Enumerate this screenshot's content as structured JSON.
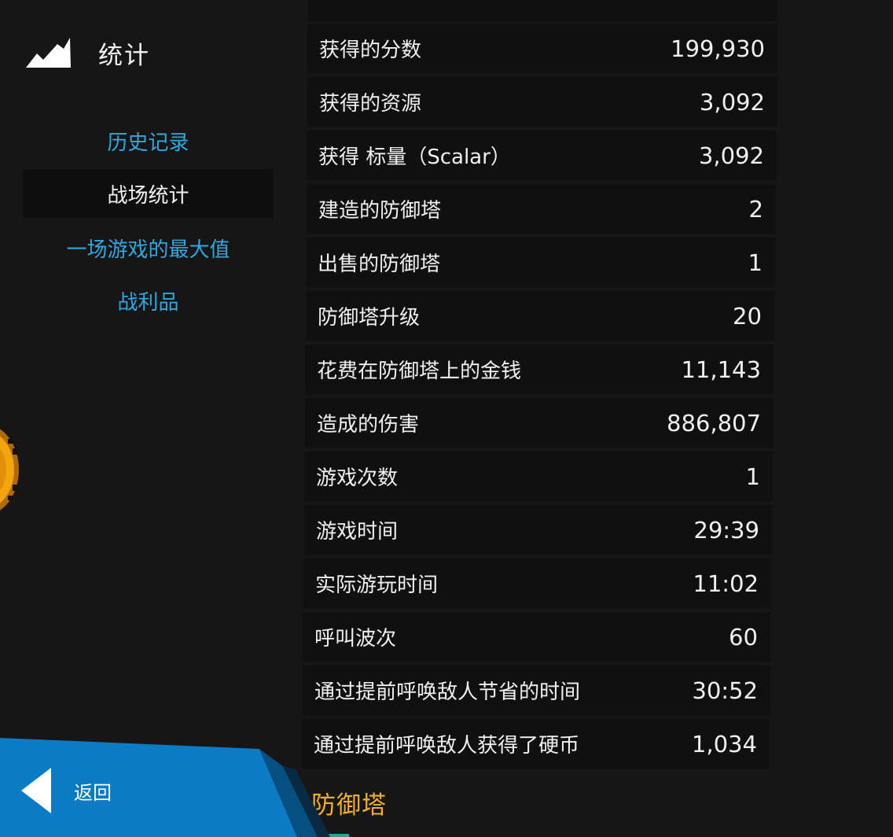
{
  "header": {
    "title": "统计",
    "icon": "mountains-icon"
  },
  "nav": {
    "items": [
      {
        "label": "历史记录",
        "active": false
      },
      {
        "label": "战场统计",
        "active": true
      },
      {
        "label": "一场游戏的最大值",
        "active": false
      },
      {
        "label": "战利品",
        "active": false
      }
    ]
  },
  "back": {
    "label": "返回",
    "icon": "back-arrow-icon"
  },
  "stats": [
    {
      "label": "获得的分数",
      "value": "199,930"
    },
    {
      "label": "获得的资源",
      "value": "3,092"
    },
    {
      "label": "获得 标量（Scalar）",
      "value": "3,092"
    },
    {
      "label": "建造的防御塔",
      "value": "2"
    },
    {
      "label": "出售的防御塔",
      "value": "1"
    },
    {
      "label": "防御塔升级",
      "value": "20"
    },
    {
      "label": "花费在防御塔上的金钱",
      "value": "11,143"
    },
    {
      "label": "造成的伤害",
      "value": "886,807"
    },
    {
      "label": "游戏次数",
      "value": "1"
    },
    {
      "label": "游戏时间",
      "value": "29:39"
    },
    {
      "label": "实际游玩时间",
      "value": "11:02"
    },
    {
      "label": "呼叫波次",
      "value": "60"
    },
    {
      "label": "通过提前呼唤敌人节省的时间",
      "value": "30:52"
    },
    {
      "label": "通过提前呼唤敌人获得了硬币",
      "value": "1,034"
    }
  ],
  "section": {
    "title": "防御塔"
  },
  "colors": {
    "background": "#161616",
    "row": "#101010",
    "link": "#2fa8e0",
    "section": "#f2b01e",
    "back": "#0a7bc4"
  }
}
